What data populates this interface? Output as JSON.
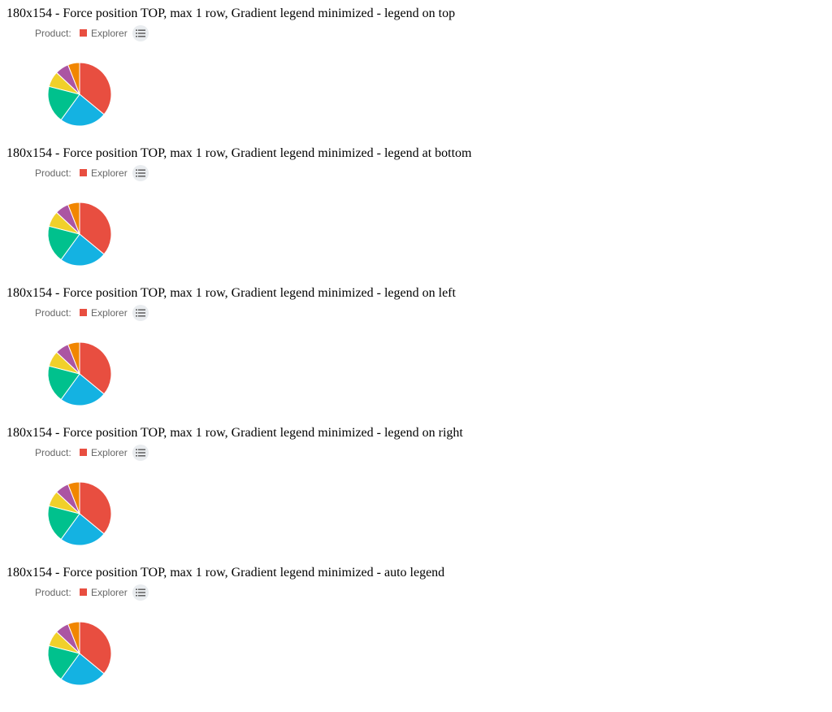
{
  "sections": [
    {
      "title": "180x154 - Force position TOP, max 1 row, Gradient legend minimized - legend on top"
    },
    {
      "title": "180x154 - Force position TOP, max 1 row, Gradient legend minimized - legend at bottom"
    },
    {
      "title": "180x154 - Force position TOP, max 1 row, Gradient legend minimized - legend on left"
    },
    {
      "title": "180x154 - Force position TOP, max 1 row, Gradient legend minimized - legend on right"
    },
    {
      "title": "180x154 - Force position TOP, max 1 row, Gradient legend minimized - auto legend"
    }
  ],
  "legend": {
    "title": "Product:",
    "item_label": "Explorer",
    "item_color": "#e84e40",
    "toggle_icon": "list-icon"
  },
  "chart_data": {
    "type": "pie",
    "slices": [
      {
        "color": "#e84e40",
        "value": 36
      },
      {
        "color": "#14b2e2",
        "value": 24
      },
      {
        "color": "#00c18d",
        "value": 19
      },
      {
        "color": "#f1d02a",
        "value": 8
      },
      {
        "color": "#ab55a3",
        "value": 7
      },
      {
        "color": "#f18600",
        "value": 6
      }
    ],
    "legend_position": "top",
    "slice_border_color": "#ffffff"
  }
}
